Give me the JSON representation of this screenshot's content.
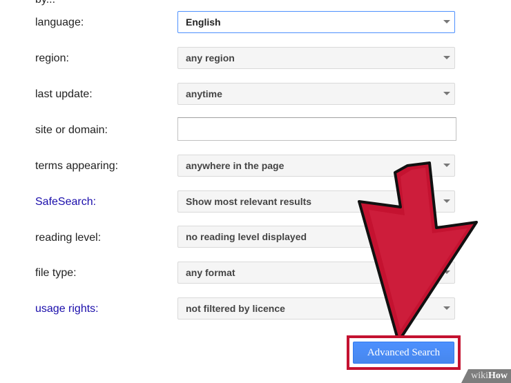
{
  "top_text": "by...",
  "rows": [
    {
      "label": "language:",
      "value": "English"
    },
    {
      "label": "region:",
      "value": "any region"
    },
    {
      "label": "last update:",
      "value": "anytime"
    },
    {
      "label": "site or domain:",
      "value": ""
    },
    {
      "label": "terms appearing:",
      "value": "anywhere in the page"
    },
    {
      "label": "SafeSearch:",
      "value": "Show most relevant results"
    },
    {
      "label": "reading level:",
      "value": "no reading level displayed"
    },
    {
      "label": "file type:",
      "value": "any format"
    },
    {
      "label": "usage rights:",
      "value": "not filtered by licence"
    }
  ],
  "button": {
    "label": "Advanced Search"
  },
  "colors": {
    "link": "#1a0dab",
    "button": "#4d90fe",
    "arrow": "#c41230",
    "focus_border": "#4d90fe"
  },
  "watermark": {
    "wiki": "wiki",
    "how": "How"
  }
}
